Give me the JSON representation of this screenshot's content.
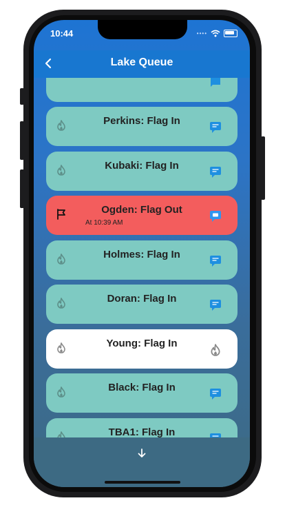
{
  "status_bar": {
    "time": "10:44",
    "signal_icon": "cellular-dots",
    "wifi_icon": "wifi-icon",
    "battery_icon": "battery-icon"
  },
  "app_bar": {
    "title": "Lake Queue",
    "back_icon": "chevron-left-icon"
  },
  "colors": {
    "app_bar": "#1877d0",
    "row_default": "#7ecac2",
    "row_flag_out": "#f35d5d",
    "row_current": "#ffffff",
    "chat_icon": "#1e8fe0"
  },
  "queue": [
    {
      "name": "Perkins:  Flag In",
      "status": "flag-in",
      "left_icon": "flame-icon",
      "right_icon": "chat-icon"
    },
    {
      "name": "Kubaki:  Flag In",
      "status": "flag-in",
      "left_icon": "flame-icon",
      "right_icon": "chat-icon"
    },
    {
      "name": "Ogden:  Flag Out",
      "subtitle": "At 10:39 AM",
      "status": "flag-out",
      "left_icon": "flag-icon",
      "right_icon": "chat-icon"
    },
    {
      "name": "Holmes:  Flag In",
      "status": "flag-in",
      "left_icon": "flame-icon",
      "right_icon": "chat-icon"
    },
    {
      "name": "Doran:  Flag In",
      "status": "flag-in",
      "left_icon": "flame-icon",
      "right_icon": "chat-icon"
    },
    {
      "name": "Young:  Flag In",
      "status": "current",
      "left_icon": "flame-icon",
      "right_icon": "flame-icon"
    },
    {
      "name": "Black:  Flag In",
      "status": "flag-in",
      "left_icon": "flame-icon",
      "right_icon": "chat-icon"
    },
    {
      "name": "TBA1:  Flag In",
      "status": "flag-in",
      "left_icon": "flame-icon",
      "right_icon": "chat-icon"
    }
  ],
  "bottom_bar": {
    "scroll_icon": "arrow-down-icon"
  }
}
